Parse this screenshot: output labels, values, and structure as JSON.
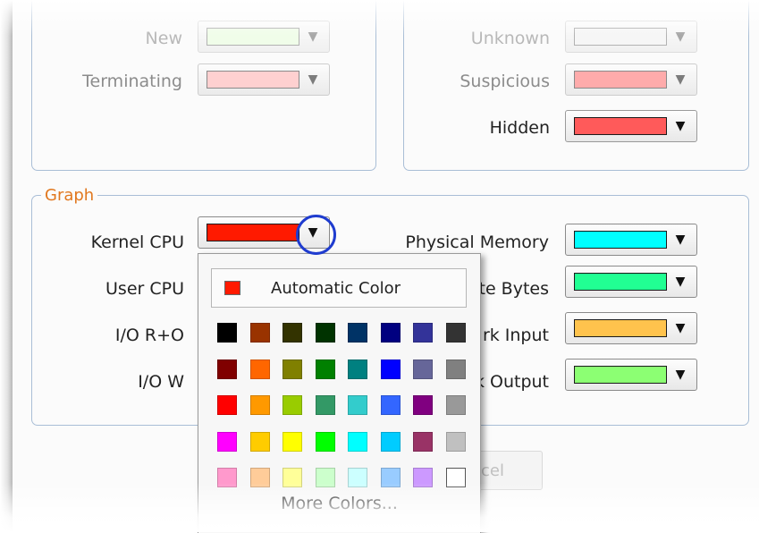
{
  "top_left_group": {
    "rows": [
      {
        "label": "New",
        "color": "#e8ffdc"
      },
      {
        "label": "Terminating",
        "color": "#ffc9c9"
      }
    ]
  },
  "top_right_group": {
    "rows": [
      {
        "label": "Unknown",
        "color": "#f2f2f2"
      },
      {
        "label": "Suspicious",
        "color": "#ff9e9e"
      },
      {
        "label": "Hidden",
        "color": "#ff5a5a"
      }
    ]
  },
  "graph_group": {
    "legend": "Graph",
    "left_rows": [
      {
        "label": "Kernel CPU",
        "color": "#ff1a00"
      },
      {
        "label": "User CPU"
      },
      {
        "label": "I/O R+O"
      },
      {
        "label": "I/O W"
      }
    ],
    "right_rows": [
      {
        "label": "Physical Memory",
        "color": "#00ffff"
      },
      {
        "label": "te Bytes",
        "color": "#21ff93"
      },
      {
        "label": "rk Input",
        "color": "#ffc34d"
      },
      {
        "label": "k Output",
        "color": "#8cff73"
      }
    ]
  },
  "color_picker": {
    "automatic_label": "Automatic Color",
    "automatic_color": "#ff1a00",
    "more_colors_label": "More Colors...",
    "palette": [
      [
        "#000000",
        "#993300",
        "#333300",
        "#003300",
        "#003366",
        "#000080",
        "#333399",
        "#333333"
      ],
      [
        "#800000",
        "#ff6600",
        "#808000",
        "#008000",
        "#008080",
        "#0000ff",
        "#666699",
        "#808080"
      ],
      [
        "#ff0000",
        "#ff9900",
        "#99cc00",
        "#339966",
        "#33cccc",
        "#3366ff",
        "#800080",
        "#999999"
      ],
      [
        "#ff00ff",
        "#ffcc00",
        "#ffff00",
        "#00ff00",
        "#00ffff",
        "#00ccff",
        "#993366",
        "#c0c0c0"
      ],
      [
        "#ff99cc",
        "#ffcc99",
        "#ffff99",
        "#ccffcc",
        "#ccffff",
        "#99ccff",
        "#cc99ff",
        "#ffffff"
      ]
    ]
  },
  "footer": {
    "cancel_label": "cel"
  },
  "icons": {
    "dropdown": "triangle-down-icon"
  }
}
